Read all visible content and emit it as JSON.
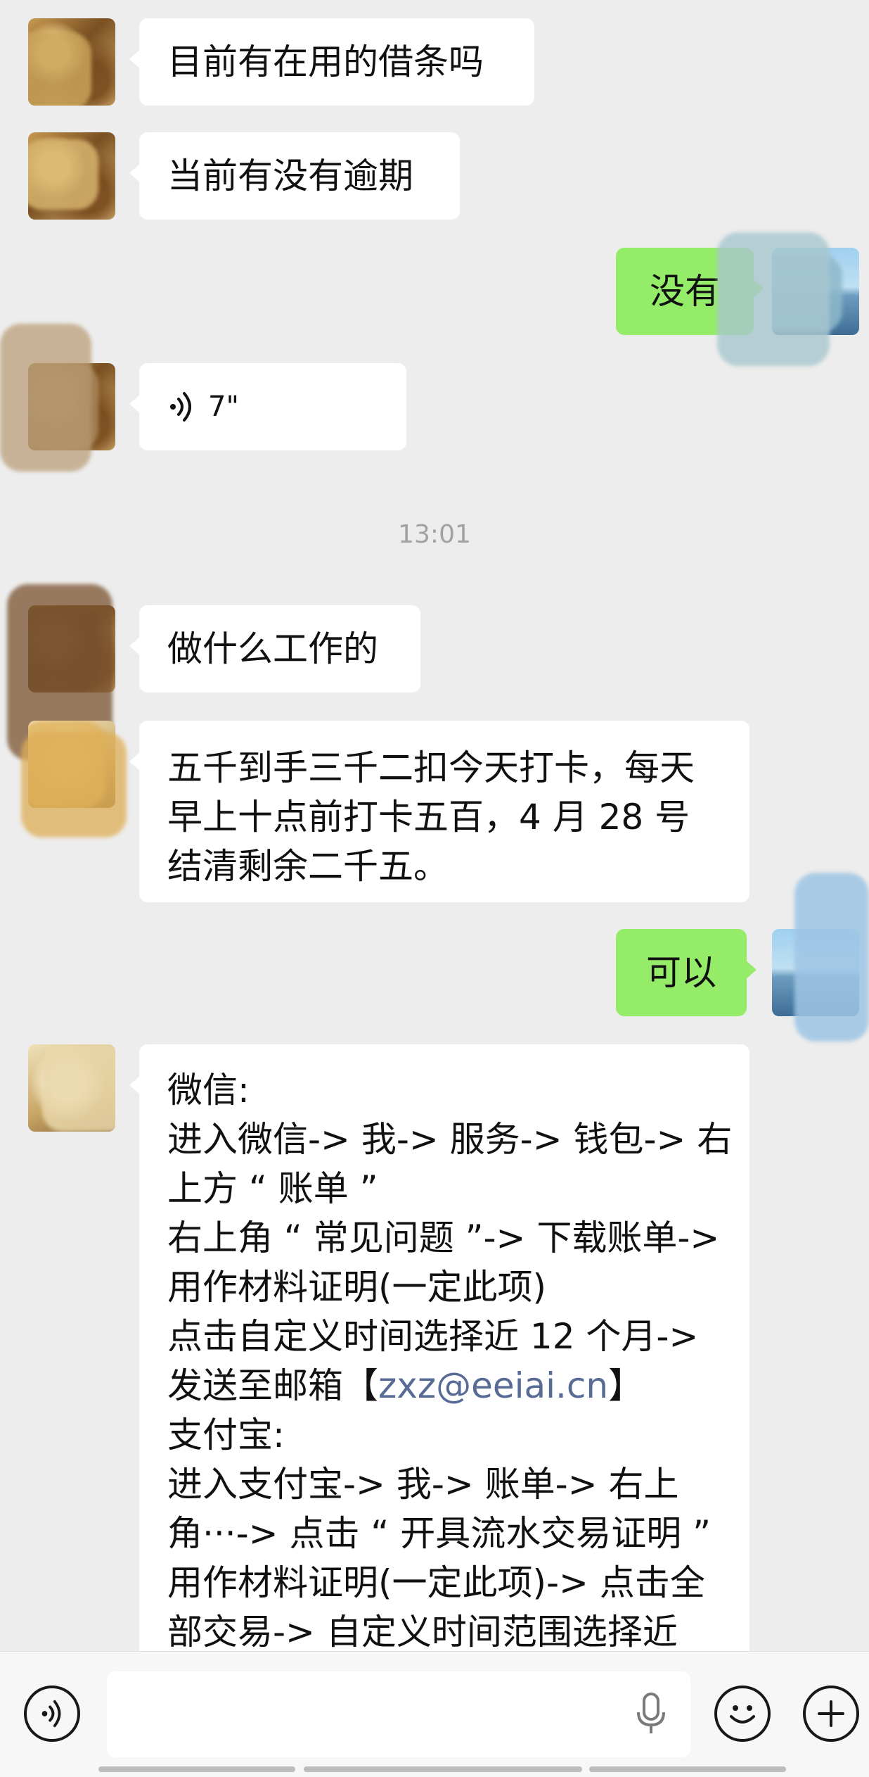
{
  "messages": [
    {
      "side": "in",
      "text": "目前有在用的借条吗"
    },
    {
      "side": "in",
      "text": "当前有没有逾期"
    },
    {
      "side": "out",
      "text": "没有"
    },
    {
      "side": "in",
      "type": "voice",
      "duration": "7\""
    },
    {
      "side": "in",
      "text": "做什么工作的"
    },
    {
      "side": "in",
      "lines": [
        "五千到手三千二扣今天打卡，每天",
        "早上十点前打卡五百，4 月 28 号",
        "结清剩余二千五。"
      ]
    },
    {
      "side": "out",
      "text": "可以"
    },
    {
      "side": "in",
      "lines": [
        "微信:",
        "进入微信-> 我-> 服务-> 钱包-> 右",
        "上方 “ 账单 ”",
        "右上角 “ 常见问题 ”-> 下载账单->",
        "用作材料证明(一定此项)",
        "点击自定义时间选择近 12 个月->",
        "发送至邮箱【zxz@eeiai.cn】",
        "支付宝:",
        "进入支付宝-> 我-> 账单-> 右上",
        "角···-> 点击 “ 开具流水交易证明 ”",
        "用作材料证明(一定此项)-> 点击全",
        "部交易-> 自定义时间范围选择近"
      ]
    }
  ],
  "email_line": {
    "prefix": "发送至邮箱【",
    "email": "zxz@eeiai.cn",
    "suffix": "】"
  },
  "timestamp": "13:01",
  "input_bar": {
    "voice_button": "voice-toggle",
    "placeholder": "",
    "mic": "microphone",
    "emoji_button": "emoji",
    "plus_button": "more-actions"
  },
  "colors": {
    "background": "#ededed",
    "incoming_bubble": "#ffffff",
    "outgoing_bubble": "#95ec69",
    "link": "#576b95",
    "timestamp": "#a2a2a2"
  }
}
